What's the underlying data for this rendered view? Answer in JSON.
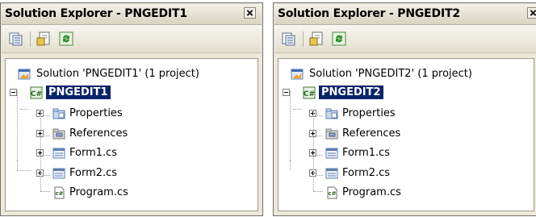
{
  "panels": [
    {
      "title": "Solution Explorer - PNGEDIT1",
      "solution_label": "Solution 'PNGEDIT1' (1 project)",
      "project_label": "PNGEDIT1",
      "items": [
        {
          "label": "Properties",
          "icon": "properties-folder-icon"
        },
        {
          "label": "References",
          "icon": "references-folder-icon"
        },
        {
          "label": "Form1.cs",
          "icon": "form-icon"
        },
        {
          "label": "Form2.cs",
          "icon": "form-icon"
        },
        {
          "label": "Program.cs",
          "icon": "csharp-file-icon"
        }
      ]
    },
    {
      "title": "Solution Explorer - PNGEDIT2",
      "solution_label": "Solution 'PNGEDIT2' (1 project)",
      "project_label": "PNGEDIT2",
      "items": [
        {
          "label": "Properties",
          "icon": "properties-folder-icon"
        },
        {
          "label": "References",
          "icon": "references-folder-icon"
        },
        {
          "label": "Form1.cs",
          "icon": "form-icon"
        },
        {
          "label": "Form2.cs",
          "icon": "form-icon"
        },
        {
          "label": "Program.cs",
          "icon": "csharp-file-icon"
        }
      ]
    }
  ],
  "colors": {
    "selection": "#0a246a",
    "panel_bg": "#ece9d8"
  }
}
